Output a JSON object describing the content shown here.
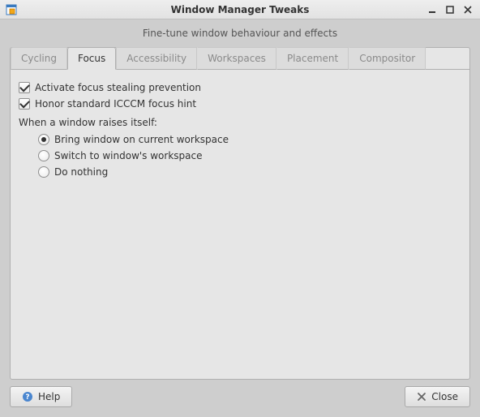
{
  "titlebar": {
    "title": "Window Manager Tweaks"
  },
  "header": {
    "subtitle": "Fine-tune window behaviour and effects"
  },
  "tabs": {
    "cycling": "Cycling",
    "focus": "Focus",
    "accessibility": "Accessibility",
    "workspaces": "Workspaces",
    "placement": "Placement",
    "compositor": "Compositor"
  },
  "focus_tab": {
    "activate_prevention": "Activate focus stealing prevention",
    "honor_icccm": "Honor standard ICCCM focus hint",
    "when_raises": "When a window raises itself:",
    "opt_bring": "Bring window on current workspace",
    "opt_switch": "Switch to window's workspace",
    "opt_nothing": "Do nothing"
  },
  "buttons": {
    "help": "Help",
    "close": "Close"
  }
}
